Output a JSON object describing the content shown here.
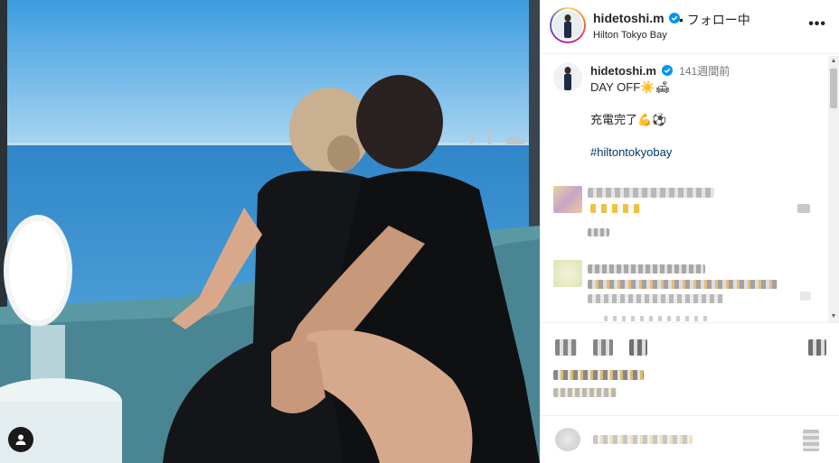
{
  "post": {
    "username": "hidetoshi.m",
    "follow_status": "• フォロー中",
    "location": "Hilton Tokyo Bay",
    "more_label": "•••"
  },
  "caption": {
    "username": "hidetoshi.m",
    "time": "141週間前",
    "line1": "DAY OFF☀️🛋",
    "line2": "充電完了💪⚽",
    "hashtag": "#hiltontokyobay"
  },
  "icons": {
    "verified": "verified-badge-icon",
    "more": "more-options-icon",
    "user_tag": "user-tag-icon"
  },
  "colors": {
    "verified": "#0095f6",
    "hashtag": "#00376b",
    "ring_start": "#feda75",
    "ring_end": "#d62976"
  }
}
